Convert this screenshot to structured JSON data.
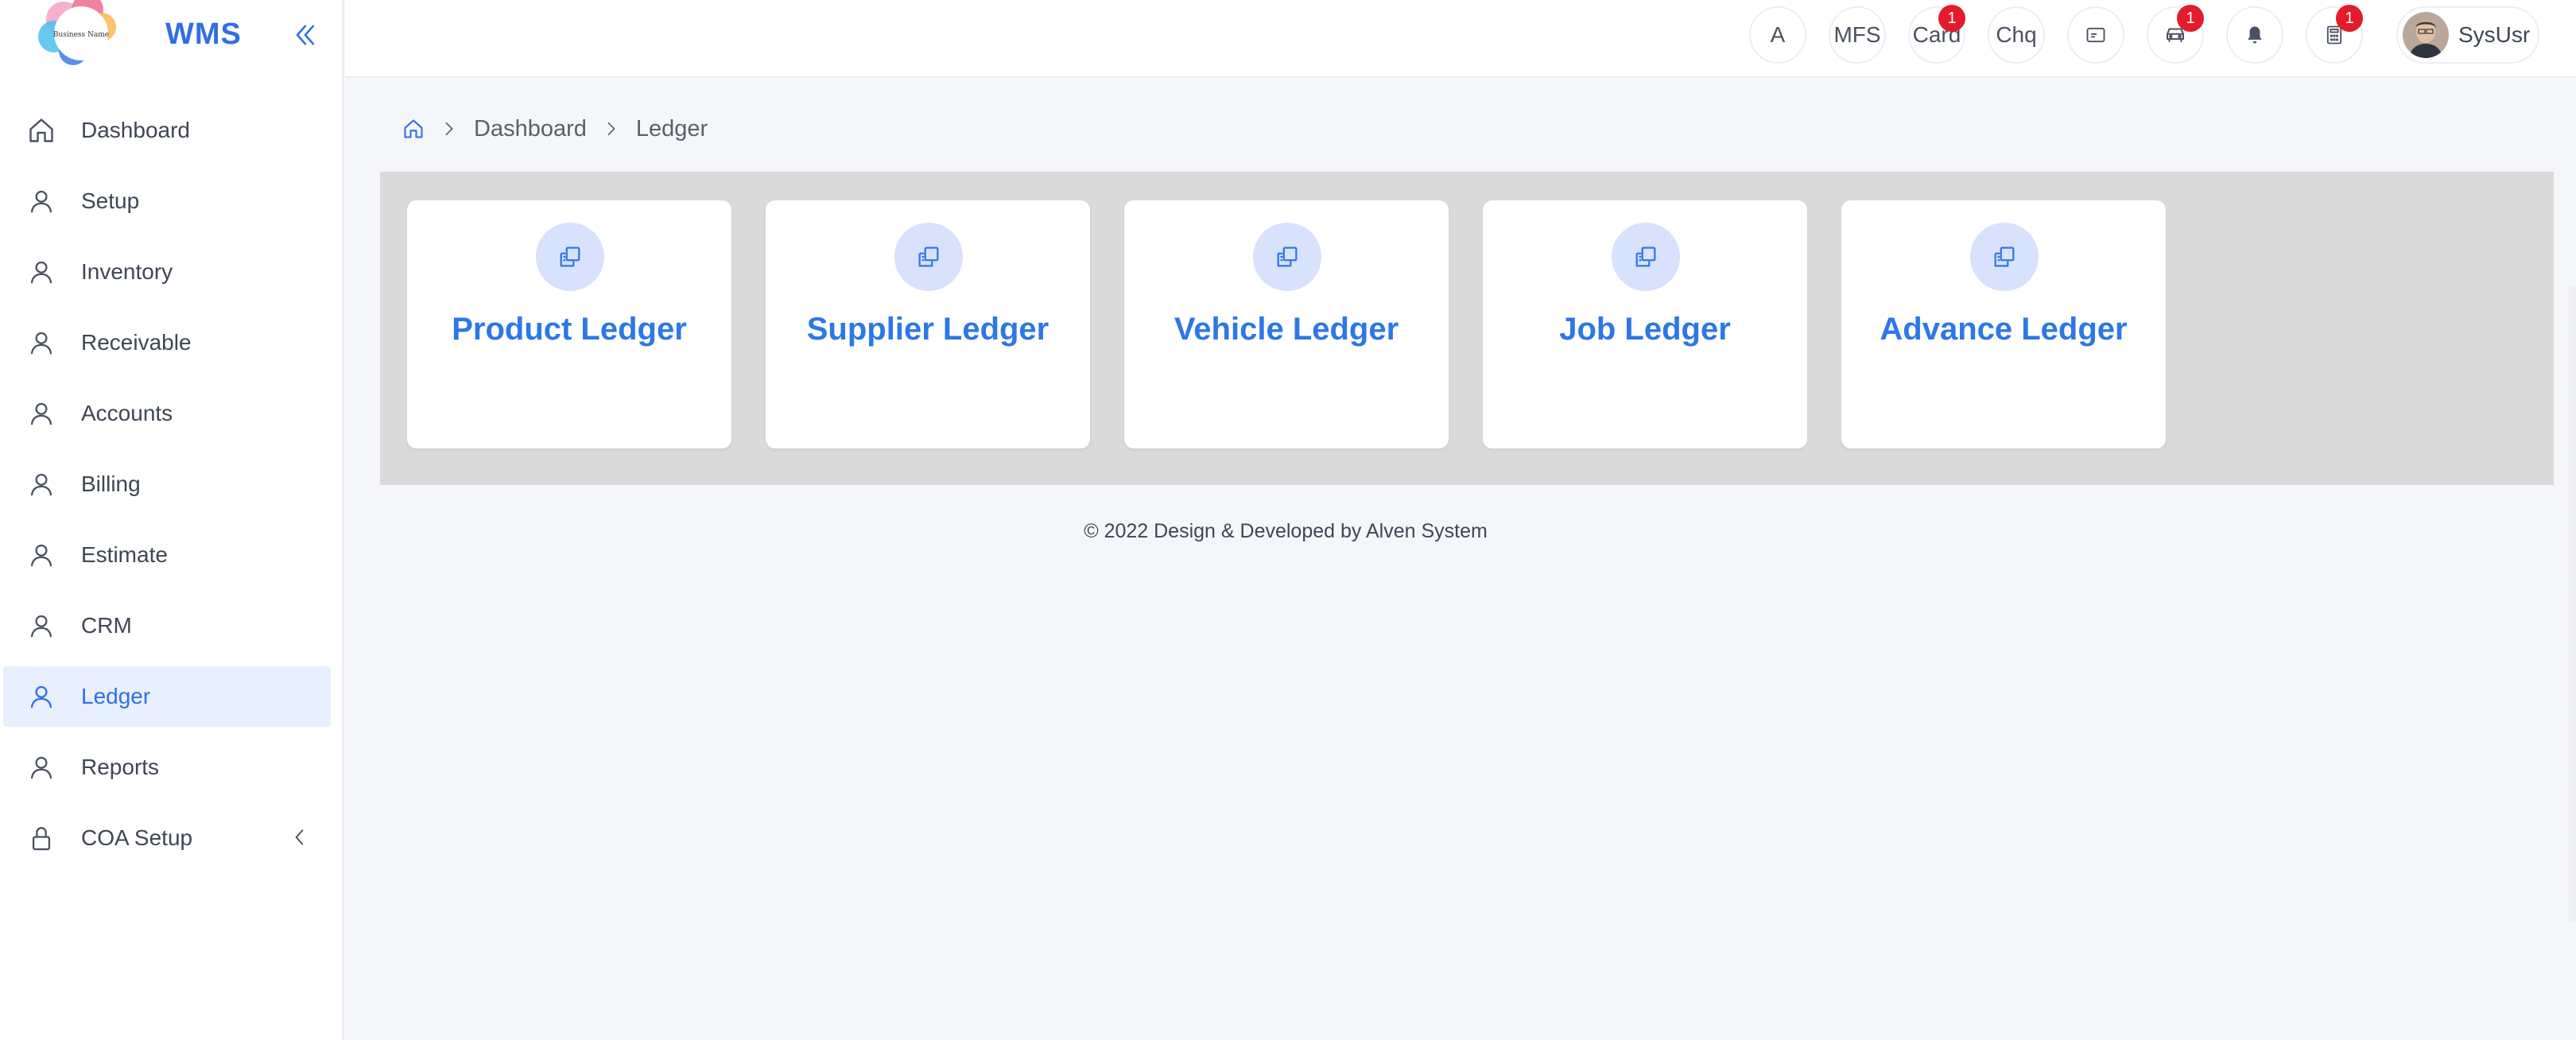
{
  "app": {
    "logo_text": "Business Name",
    "brand": "WMS"
  },
  "sidebar": {
    "items": [
      {
        "label": "Dashboard",
        "icon": "home-icon"
      },
      {
        "label": "Setup",
        "icon": "user-icon"
      },
      {
        "label": "Inventory",
        "icon": "user-icon"
      },
      {
        "label": "Receivable",
        "icon": "user-icon"
      },
      {
        "label": "Accounts",
        "icon": "user-icon"
      },
      {
        "label": "Billing",
        "icon": "user-icon"
      },
      {
        "label": "Estimate",
        "icon": "user-icon"
      },
      {
        "label": "CRM",
        "icon": "user-icon"
      },
      {
        "label": "Ledger",
        "icon": "user-icon",
        "active": true
      },
      {
        "label": "Reports",
        "icon": "user-icon"
      },
      {
        "label": "COA Setup",
        "icon": "lock-icon"
      }
    ]
  },
  "topbar": {
    "a_label": "A",
    "mfs_label": "MFS",
    "card_label": "Card",
    "card_badge": "1",
    "chq_label": "Chq",
    "vehicle_badge": "1",
    "calculator_badge": "1",
    "user_name": "SysUsr"
  },
  "breadcrumb": {
    "dashboard": "Dashboard",
    "current": "Ledger"
  },
  "cards": [
    {
      "title": "Product Ledger"
    },
    {
      "title": "Supplier Ledger"
    },
    {
      "title": "Vehicle Ledger"
    },
    {
      "title": "Job Ledger"
    },
    {
      "title": "Advance Ledger"
    }
  ],
  "footer": {
    "text": "© 2022 Design & Developed by Alven System"
  },
  "colors": {
    "accent": "#2f6fe4",
    "card_title": "#2d77e6",
    "badge": "#e41b2b",
    "panel_bg": "#dadada",
    "active_bg": "#e8efff"
  }
}
